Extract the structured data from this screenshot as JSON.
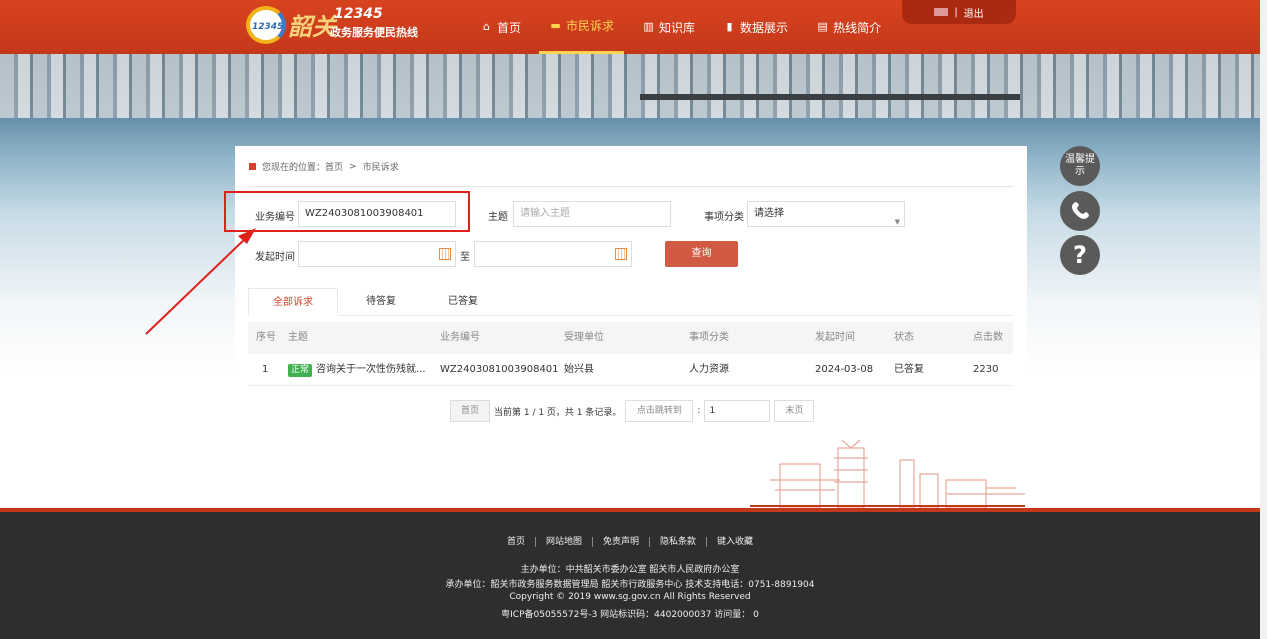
{
  "header": {
    "logo_num": "12345",
    "logo_big": "韶关",
    "logo_sub": "政务服务便民热线",
    "logo_small": "12345",
    "nav": [
      "首页",
      "市民诉求",
      "知识库",
      "数据展示",
      "热线简介"
    ],
    "logout": "退出"
  },
  "breadcrumb": {
    "prefix": "您现在的位置：首页",
    "sep": ">",
    "current": "市民诉求"
  },
  "search": {
    "biz_label": "业务编号",
    "biz_value": "WZ2403081003908401",
    "subject_label": "主题",
    "subject_placeholder": "请输入主题",
    "category_label": "事项分类",
    "category_value": "请选择",
    "time_label": "发起时间",
    "to_label": "至",
    "query_button": "查询"
  },
  "tabs": [
    "全部诉求",
    "待答复",
    "已答复"
  ],
  "table": {
    "headers": [
      "序号",
      "主题",
      "业务编号",
      "受理单位",
      "事项分类",
      "发起时间",
      "状态",
      "点击数"
    ],
    "rows": [
      {
        "no": "1",
        "badge": "正常",
        "subject": "咨询关于一次性伤残就...",
        "biz": "WZ2403081003908401",
        "unit": "始兴县",
        "category": "人力资源",
        "date": "2024-03-08",
        "status": "已答复",
        "clicks": "2230"
      }
    ]
  },
  "pager": {
    "first": "首页",
    "info": "当前第 1 / 1 页，共 1 条记录。",
    "jump": "点击跳转到",
    "colon": ":",
    "page_value": "1",
    "last": "末页"
  },
  "side": {
    "tip": "温馨提示",
    "phone_icon": "phone-icon",
    "help": "?"
  },
  "footer": {
    "links": [
      "首页",
      "网站地图",
      "免责声明",
      "隐私条款",
      "键入收藏"
    ],
    "host": "主办单位：中共韶关市委办公室 韶关市人民政府办公室",
    "organizer": "承办单位：韶关市政务服务数据管理局 韶关市行政服务中心    技术支持电话：0751-8891904",
    "copyright": "Copyright © 2019 www.sg.gov.cn All Rights Reserved",
    "icp": "粤ICP备05055572号-3     网站标识码：4402000037     访问量：  0"
  },
  "colors": {
    "brand": "#c4381a",
    "accent": "#ffd34d",
    "annotation": "#e0201b"
  }
}
